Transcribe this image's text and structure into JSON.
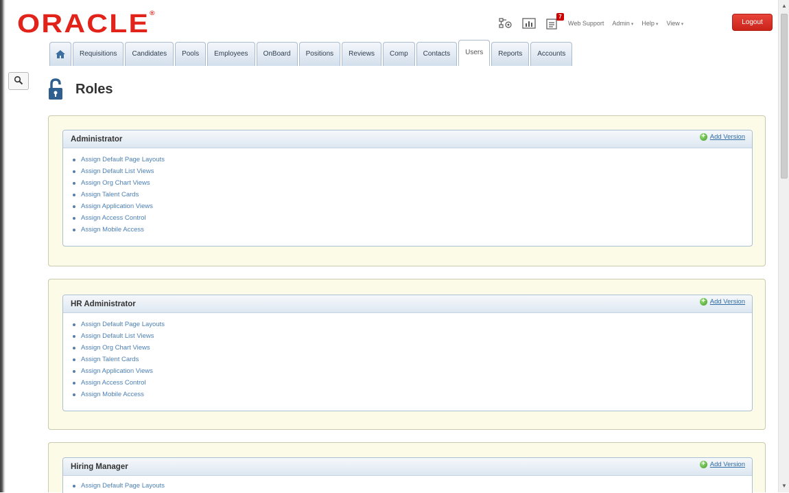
{
  "brand": {
    "logo_text": "ORACLE",
    "registered_mark": "®"
  },
  "header": {
    "notification_count": "7",
    "web_support": "Web Support",
    "admin_menu": "Admin",
    "help_menu": "Help",
    "view_menu": "View",
    "logout": "Logout"
  },
  "tabs": [
    {
      "label": "Requisitions"
    },
    {
      "label": "Candidates"
    },
    {
      "label": "Pools"
    },
    {
      "label": "Employees"
    },
    {
      "label": "OnBoard"
    },
    {
      "label": "Positions"
    },
    {
      "label": "Reviews"
    },
    {
      "label": "Comp"
    },
    {
      "label": "Contacts"
    },
    {
      "label": "Users",
      "active": true
    },
    {
      "label": "Reports"
    },
    {
      "label": "Accounts"
    }
  ],
  "page": {
    "title": "Roles"
  },
  "add_version_label": "Add Version",
  "roles": [
    {
      "name": "Administrator",
      "permissions": [
        "Assign Default Page Layouts",
        "Assign Default List Views",
        "Assign Org Chart Views",
        "Assign Talent Cards",
        "Assign Application Views",
        "Assign Access Control",
        "Assign Mobile Access"
      ]
    },
    {
      "name": "HR Administrator",
      "permissions": [
        "Assign Default Page Layouts",
        "Assign Default List Views",
        "Assign Org Chart Views",
        "Assign Talent Cards",
        "Assign Application Views",
        "Assign Access Control",
        "Assign Mobile Access"
      ]
    },
    {
      "name": "Hiring Manager",
      "permissions": [
        "Assign Default Page Layouts"
      ]
    }
  ],
  "colors": {
    "brand_red": "#e2231a",
    "link_blue": "#4a7fb3",
    "section_bg": "#fbfbe8",
    "tab_border": "#a9bccf"
  }
}
